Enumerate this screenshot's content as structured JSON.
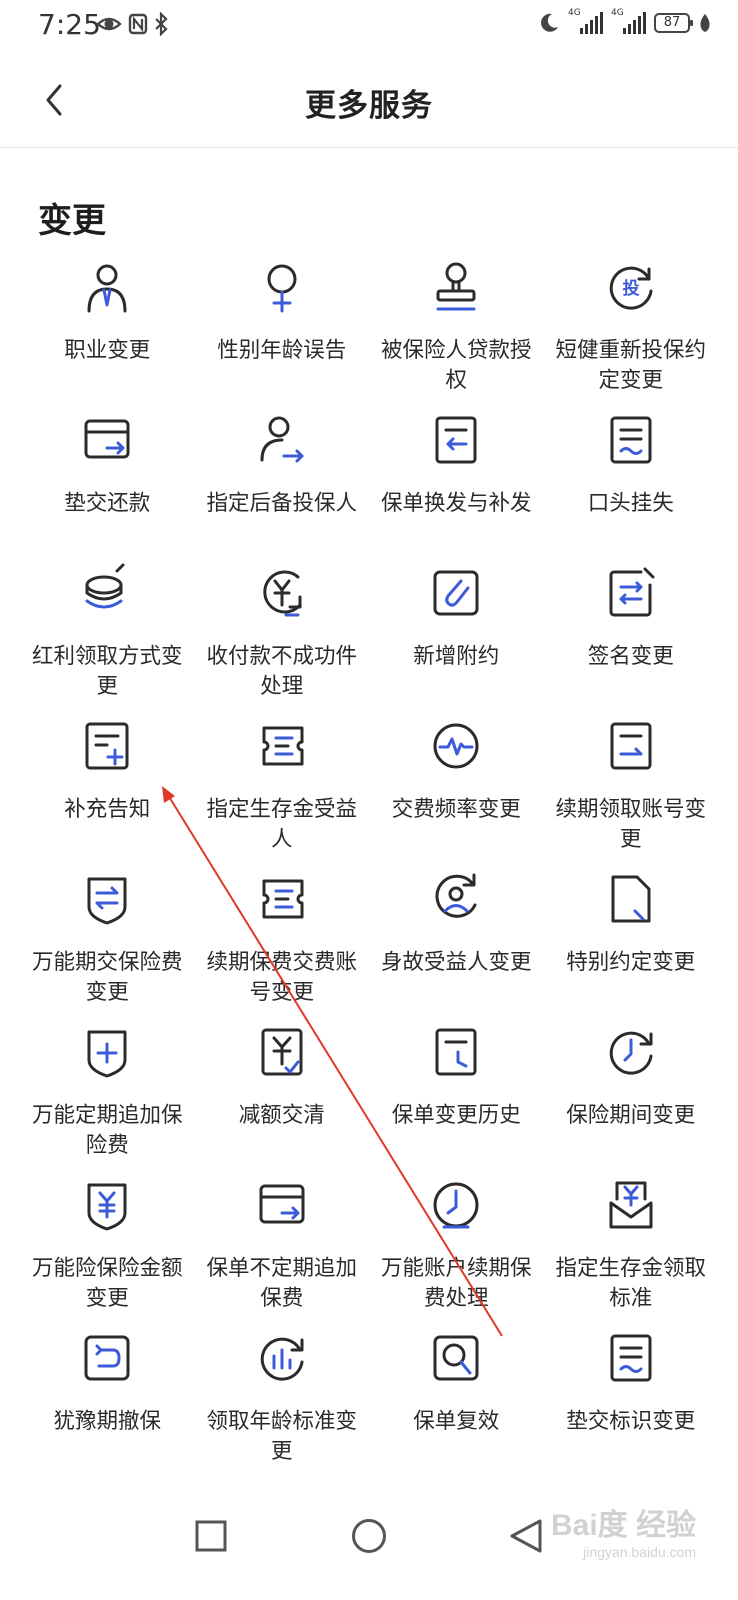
{
  "status_bar": {
    "time": "7:25",
    "network_left": "4G",
    "network_right": "4G",
    "battery": "87"
  },
  "header": {
    "title": "更多服务"
  },
  "section": {
    "title": "变更"
  },
  "colors": {
    "accent": "#3d5bd8",
    "icon_stroke": "#2b2b2b",
    "annotation": "#e0392b"
  },
  "services": [
    {
      "label": "职业变更",
      "icon": "occupation-icon"
    },
    {
      "label": "性别年龄误告",
      "icon": "gender-age-icon"
    },
    {
      "label": "被保险人贷款授权",
      "icon": "stamp-icon"
    },
    {
      "label": "短健重新投保约定变更",
      "icon": "reinsure-icon"
    },
    {
      "label": "垫交还款",
      "icon": "card-transfer-icon"
    },
    {
      "label": "指定后备投保人",
      "icon": "person-arrow-icon"
    },
    {
      "label": "保单换发与补发",
      "icon": "doc-return-icon"
    },
    {
      "label": "口头挂失",
      "icon": "doc-wave-icon"
    },
    {
      "label": "红利领取方式变更",
      "icon": "coins-icon"
    },
    {
      "label": "收付款不成功件处理",
      "icon": "yuan-cycle-icon"
    },
    {
      "label": "新增附约",
      "icon": "paperclip-icon"
    },
    {
      "label": "签名变更",
      "icon": "signature-icon"
    },
    {
      "label": "补充告知",
      "icon": "doc-plus-icon"
    },
    {
      "label": "指定生存金受益人",
      "icon": "ticket-icon"
    },
    {
      "label": "交费频率变更",
      "icon": "pulse-icon"
    },
    {
      "label": "续期领取账号变更",
      "icon": "doc-arrow-icon"
    },
    {
      "label": "万能期交保险费变更",
      "icon": "shield-swap-icon"
    },
    {
      "label": "续期保费交费账号变更",
      "icon": "ticket-icon"
    },
    {
      "label": "身故受益人变更",
      "icon": "person-cycle-icon"
    },
    {
      "label": "特别约定变更",
      "icon": "doc-fold-icon"
    },
    {
      "label": "万能定期追加保险费",
      "icon": "shield-plus-icon"
    },
    {
      "label": "减额交清",
      "icon": "yuan-check-icon"
    },
    {
      "label": "保单变更历史",
      "icon": "doc-history-icon"
    },
    {
      "label": "保险期间变更",
      "icon": "clock-cycle-icon"
    },
    {
      "label": "万能险保险金额变更",
      "icon": "shield-yuan-icon"
    },
    {
      "label": "保单不定期追加保费",
      "icon": "card-transfer-icon"
    },
    {
      "label": "万能账户续期保费处理",
      "icon": "clock-icon"
    },
    {
      "label": "指定生存金领取标准",
      "icon": "envelope-yuan-icon"
    },
    {
      "label": "犹豫期撤保",
      "icon": "undo-box-icon"
    },
    {
      "label": "领取年龄标准变更",
      "icon": "chart-cycle-icon"
    },
    {
      "label": "保单复效",
      "icon": "magnifier-icon"
    },
    {
      "label": "垫交标识变更",
      "icon": "doc-wave-icon"
    }
  ],
  "watermark": {
    "logo": "Bai度 经验",
    "url": "jingyan.baidu.com"
  }
}
